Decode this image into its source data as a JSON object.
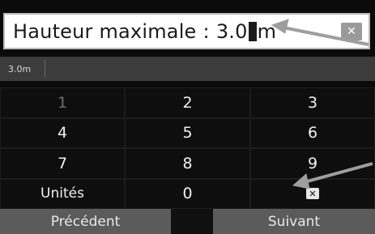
{
  "input": {
    "label": "Hauteur maximale",
    "separator": ":",
    "value_before_cursor": "3.0",
    "unit": "m",
    "clear_icon": "close-icon"
  },
  "preview": {
    "value": "3.0m"
  },
  "keypad": {
    "keys": [
      "1",
      "2",
      "3",
      "4",
      "5",
      "6",
      "7",
      "8",
      "9",
      "Unités",
      "0",
      "delete-icon"
    ]
  },
  "actions": {
    "prev_label": "Précédent",
    "next_label": "Suivant"
  },
  "annotations": [
    {
      "name": "arrow-to-input",
      "icon": "arrow-left-icon",
      "color": "#9e9e9e"
    },
    {
      "name": "arrow-to-delete",
      "icon": "arrow-left-icon",
      "color": "#9e9e9e"
    }
  ]
}
